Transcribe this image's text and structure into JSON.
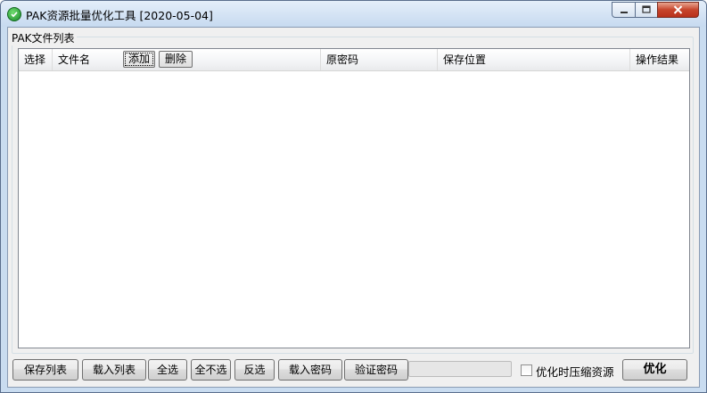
{
  "window": {
    "title": "PAK资源批量优化工具 [2020-05-04]",
    "icon": "check-shield-icon",
    "controls": {
      "minimize": "_",
      "maximize": "□",
      "close": "✕"
    }
  },
  "group": {
    "label": "PAK文件列表"
  },
  "list": {
    "columns": [
      "选择",
      "文件名",
      "原密码",
      "保存位置",
      "操作结果"
    ],
    "header_buttons": {
      "add": "添加",
      "delete": "删除"
    },
    "rows": []
  },
  "bottom": {
    "save_list": "保存列表",
    "load_list": "载入列表",
    "select_all": "全选",
    "select_none": "全不选",
    "invert": "反选",
    "load_password": "载入密码",
    "verify_password": "验证密码",
    "progress": 0,
    "compress_checkbox": {
      "label": "优化时压缩资源",
      "checked": false
    },
    "optimize": "优化"
  },
  "colors": {
    "title_gradient_top": "#e4eef9",
    "close_red": "#c7452c",
    "progress_green": "#06b025"
  }
}
